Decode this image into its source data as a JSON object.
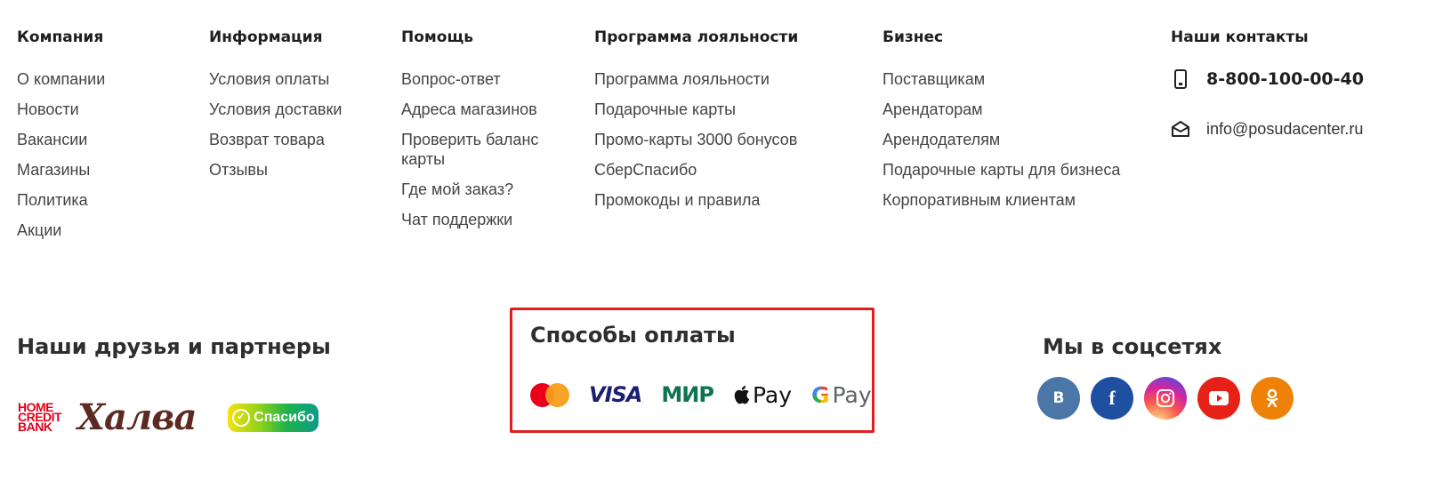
{
  "columns": [
    {
      "title": "Компания",
      "items": [
        "О компании",
        "Новости",
        "Вакансии",
        "Магазины",
        "Политика",
        "Акции"
      ]
    },
    {
      "title": "Информация",
      "items": [
        "Условия оплаты",
        "Условия доставки",
        "Возврат товара",
        "Отзывы"
      ]
    },
    {
      "title": "Помощь",
      "items": [
        "Вопрос-ответ",
        "Адреса магазинов",
        "Проверить баланс карты",
        "Где мой заказ?",
        "Чат поддержки"
      ]
    },
    {
      "title": "Программа лояльности",
      "items": [
        "Программа лояльности",
        "Подарочные карты",
        "Промо-карты 3000 бонусов",
        "СберСпасибо",
        "Промокоды и правила"
      ]
    },
    {
      "title": "Бизнес",
      "items": [
        "Поставщикам",
        "Арендаторам",
        "Арендодателям",
        "Подарочные карты для бизнеса",
        "Корпоративным клиентам"
      ]
    }
  ],
  "contacts": {
    "title": "Наши контакты",
    "phone": "8-800-100-00-40",
    "email": "info@posudacenter.ru"
  },
  "partners": {
    "title": "Наши друзья и партнеры",
    "home_credit_label": "HOME\nCREDIT\nBANK",
    "halva_label": "Халва",
    "spasibo_label": "Спасибо"
  },
  "payment": {
    "title": "Способы оплаты",
    "visa_label": "VISA",
    "mir_label": "МИР",
    "apple_pay_label": "Pay",
    "google_pay_label": "Pay",
    "google_g": "G",
    "highlight_color": "#e01e1e"
  },
  "social": {
    "title": "Мы в соцсетях",
    "vk_label": "B",
    "fb_label": "f",
    "colors": {
      "vk": "#4a76a8",
      "fb": "#1e4fa0",
      "ok": "#ee8208",
      "yt": "#e62117"
    }
  }
}
